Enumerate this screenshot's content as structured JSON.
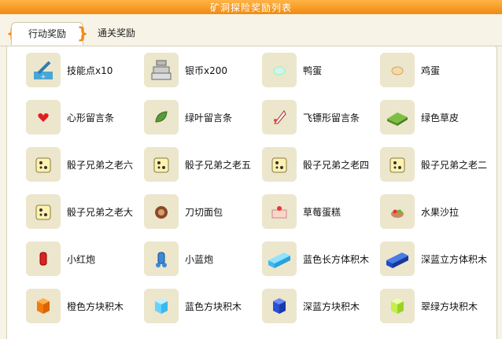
{
  "window": {
    "title": "矿洞探险奖励列表"
  },
  "tabs": [
    {
      "label": "行动奖励",
      "active": true
    },
    {
      "label": "通关奖励",
      "active": false
    }
  ],
  "rewards": [
    {
      "label": "技能点x10",
      "icon": "skill-points-icon"
    },
    {
      "label": "银币x200",
      "icon": "silver-coin-icon"
    },
    {
      "label": "鸭蛋",
      "icon": "duck-egg-icon"
    },
    {
      "label": "鸡蛋",
      "icon": "chicken-egg-icon"
    },
    {
      "label": "心形留言条",
      "icon": "heart-note-icon"
    },
    {
      "label": "绿叶留言条",
      "icon": "leaf-note-icon"
    },
    {
      "label": "飞镖形留言条",
      "icon": "dart-note-icon"
    },
    {
      "label": "绿色草皮",
      "icon": "grass-turf-icon"
    },
    {
      "label": "骰子兄弟之老六",
      "icon": "dice-icon"
    },
    {
      "label": "骰子兄弟之老五",
      "icon": "dice-icon"
    },
    {
      "label": "骰子兄弟之老四",
      "icon": "dice-icon"
    },
    {
      "label": "骰子兄弟之老二",
      "icon": "dice-icon"
    },
    {
      "label": "骰子兄弟之老大",
      "icon": "dice-icon"
    },
    {
      "label": "刀切面包",
      "icon": "bread-icon"
    },
    {
      "label": "草莓蛋糕",
      "icon": "strawberry-cake-icon"
    },
    {
      "label": "水果沙拉",
      "icon": "fruit-salad-icon"
    },
    {
      "label": "小红炮",
      "icon": "red-cannon-icon"
    },
    {
      "label": "小蓝炮",
      "icon": "blue-cannon-icon"
    },
    {
      "label": "蓝色长方体积木",
      "icon": "blue-long-block-icon"
    },
    {
      "label": "深蓝立方体积木",
      "icon": "dark-blue-long-block-icon"
    },
    {
      "label": "橙色方块积木",
      "icon": "orange-cube-icon"
    },
    {
      "label": "蓝色方块积木",
      "icon": "blue-cube-icon"
    },
    {
      "label": "深蓝方块积木",
      "icon": "dark-blue-cube-icon"
    },
    {
      "label": "翠绿方块积木",
      "icon": "green-cube-icon"
    }
  ],
  "colors": {
    "accent": "#f08a10",
    "panel_bg": "#ffffff",
    "icon_bg": "#ece6cc"
  }
}
